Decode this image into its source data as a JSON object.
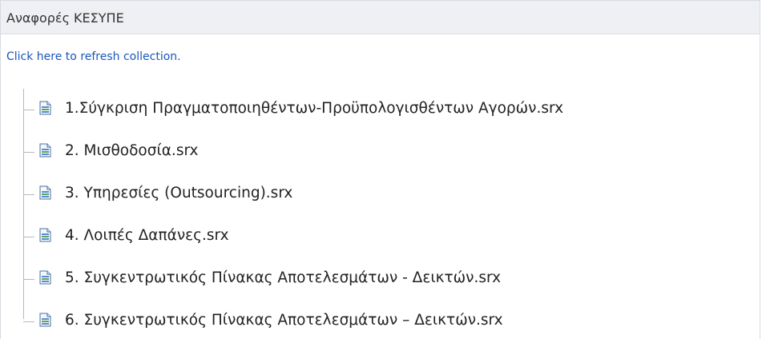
{
  "panel": {
    "title": "Αναφορές ΚΕΣΥΠΕ",
    "refresh_link": "Click here to refresh collection."
  },
  "tree": {
    "items": [
      {
        "label": "1.Σύγκριση Πραγματοποιηθέντων-Προϋπολογισθέντων Αγορών.srx",
        "icon": "report-file-icon"
      },
      {
        "label": "2. Μισθοδοσία.srx",
        "icon": "report-file-icon"
      },
      {
        "label": "3. Υπηρεσίες (Outsourcing).srx",
        "icon": "report-file-icon"
      },
      {
        "label": "4. Λοιπές Δαπάνες.srx",
        "icon": "report-file-icon"
      },
      {
        "label": "5. Συγκεντρωτικός Πίνακας Αποτελεσμάτων - Δεικτών.srx",
        "icon": "report-file-icon"
      },
      {
        "label": "6. Συγκεντρωτικός Πίνακας Αποτελεσμάτων – Δεικτών.srx",
        "icon": "report-file-icon"
      }
    ]
  },
  "colors": {
    "header_bg": "#eef0f3",
    "link": "#1a56b8",
    "text": "#222222",
    "tree_line": "#b8b8b8"
  }
}
